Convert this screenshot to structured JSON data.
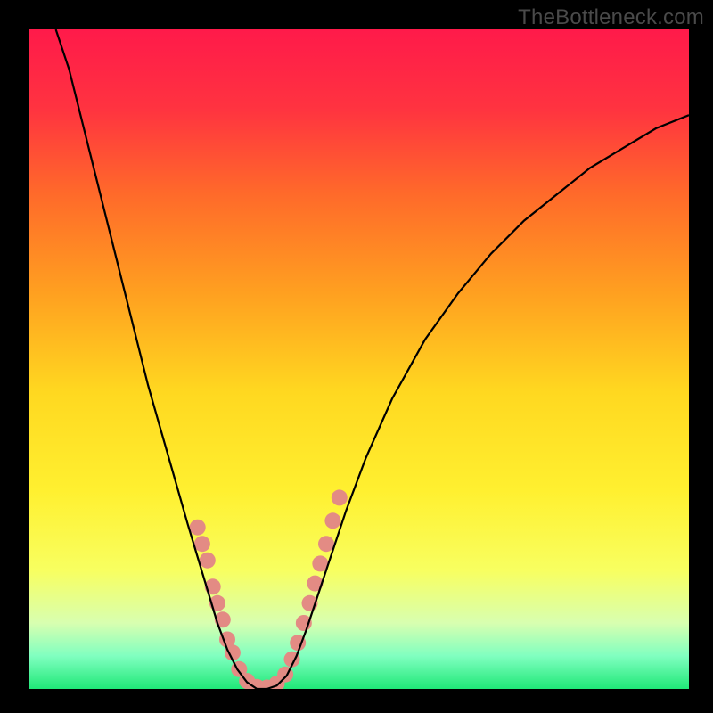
{
  "watermark": "TheBottleneck.com",
  "chart_data": {
    "type": "line",
    "title": "",
    "xlabel": "",
    "ylabel": "",
    "xlim": [
      0,
      1
    ],
    "ylim": [
      0,
      1
    ],
    "gradient_stops": [
      {
        "pos": 0.0,
        "color": "#ff1a4a"
      },
      {
        "pos": 0.12,
        "color": "#ff3340"
      },
      {
        "pos": 0.25,
        "color": "#ff6a2a"
      },
      {
        "pos": 0.4,
        "color": "#ffa020"
      },
      {
        "pos": 0.55,
        "color": "#ffd820"
      },
      {
        "pos": 0.7,
        "color": "#fff030"
      },
      {
        "pos": 0.82,
        "color": "#f8ff60"
      },
      {
        "pos": 0.9,
        "color": "#d8ffb0"
      },
      {
        "pos": 0.95,
        "color": "#80ffc0"
      },
      {
        "pos": 1.0,
        "color": "#20e878"
      }
    ],
    "series": [
      {
        "name": "curve",
        "stroke": "#000000",
        "points": [
          {
            "x": 0.04,
            "y": 1.0
          },
          {
            "x": 0.06,
            "y": 0.94
          },
          {
            "x": 0.08,
            "y": 0.86
          },
          {
            "x": 0.1,
            "y": 0.78
          },
          {
            "x": 0.12,
            "y": 0.7
          },
          {
            "x": 0.14,
            "y": 0.62
          },
          {
            "x": 0.16,
            "y": 0.54
          },
          {
            "x": 0.18,
            "y": 0.46
          },
          {
            "x": 0.2,
            "y": 0.39
          },
          {
            "x": 0.22,
            "y": 0.32
          },
          {
            "x": 0.24,
            "y": 0.25
          },
          {
            "x": 0.255,
            "y": 0.2
          },
          {
            "x": 0.27,
            "y": 0.15
          },
          {
            "x": 0.285,
            "y": 0.1
          },
          {
            "x": 0.3,
            "y": 0.06
          },
          {
            "x": 0.315,
            "y": 0.03
          },
          {
            "x": 0.33,
            "y": 0.01
          },
          {
            "x": 0.345,
            "y": 0.0
          },
          {
            "x": 0.36,
            "y": 0.0
          },
          {
            "x": 0.375,
            "y": 0.005
          },
          {
            "x": 0.39,
            "y": 0.02
          },
          {
            "x": 0.405,
            "y": 0.05
          },
          {
            "x": 0.42,
            "y": 0.09
          },
          {
            "x": 0.44,
            "y": 0.15
          },
          {
            "x": 0.46,
            "y": 0.21
          },
          {
            "x": 0.48,
            "y": 0.27
          },
          {
            "x": 0.51,
            "y": 0.35
          },
          {
            "x": 0.55,
            "y": 0.44
          },
          {
            "x": 0.6,
            "y": 0.53
          },
          {
            "x": 0.65,
            "y": 0.6
          },
          {
            "x": 0.7,
            "y": 0.66
          },
          {
            "x": 0.75,
            "y": 0.71
          },
          {
            "x": 0.8,
            "y": 0.75
          },
          {
            "x": 0.85,
            "y": 0.79
          },
          {
            "x": 0.9,
            "y": 0.82
          },
          {
            "x": 0.95,
            "y": 0.85
          },
          {
            "x": 1.0,
            "y": 0.87
          }
        ]
      }
    ],
    "markers": [
      {
        "x": 0.255,
        "y": 0.245
      },
      {
        "x": 0.262,
        "y": 0.22
      },
      {
        "x": 0.27,
        "y": 0.195
      },
      {
        "x": 0.278,
        "y": 0.155
      },
      {
        "x": 0.285,
        "y": 0.13
      },
      {
        "x": 0.293,
        "y": 0.105
      },
      {
        "x": 0.3,
        "y": 0.075
      },
      {
        "x": 0.308,
        "y": 0.055
      },
      {
        "x": 0.318,
        "y": 0.03
      },
      {
        "x": 0.33,
        "y": 0.012
      },
      {
        "x": 0.345,
        "y": 0.003
      },
      {
        "x": 0.36,
        "y": 0.002
      },
      {
        "x": 0.375,
        "y": 0.008
      },
      {
        "x": 0.388,
        "y": 0.022
      },
      {
        "x": 0.398,
        "y": 0.045
      },
      {
        "x": 0.407,
        "y": 0.07
      },
      {
        "x": 0.416,
        "y": 0.1
      },
      {
        "x": 0.425,
        "y": 0.13
      },
      {
        "x": 0.433,
        "y": 0.16
      },
      {
        "x": 0.441,
        "y": 0.19
      },
      {
        "x": 0.45,
        "y": 0.22
      },
      {
        "x": 0.46,
        "y": 0.255
      },
      {
        "x": 0.47,
        "y": 0.29
      }
    ],
    "marker_color": "#e38b84",
    "marker_radius": 9
  }
}
